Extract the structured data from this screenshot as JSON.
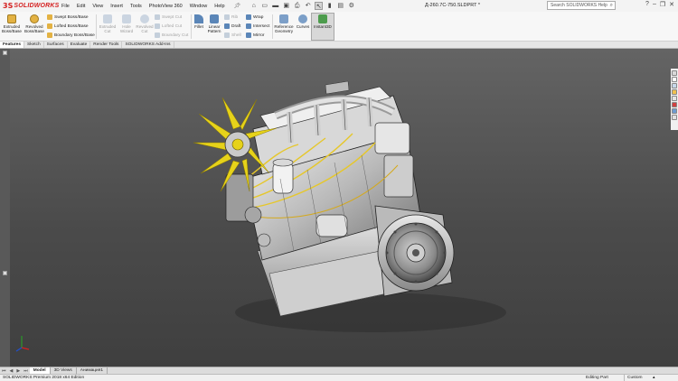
{
  "app": {
    "logo_ds": "3S",
    "logo_text": "SOLIDWORKS"
  },
  "menu": [
    "File",
    "Edit",
    "View",
    "Insert",
    "Tools",
    "PhotoView 360",
    "Window",
    "Help"
  ],
  "document_title": "Д-260.7C-750.SLDPRT *",
  "search": {
    "placeholder": "Search SOLIDWORKS Help"
  },
  "ribbon": {
    "extruded_boss": "Extruded Boss/Base",
    "revolved_boss": "Revolved Boss/Base",
    "swept_boss": "Swept Boss/Base",
    "lofted_boss": "Lofted Boss/Base",
    "boundary_boss": "Boundary Boss/Base",
    "extruded_cut": "Extruded Cut",
    "hole_wizard": "Hole Wizard",
    "revolved_cut": "Revolved Cut",
    "swept_cut": "Swept Cut",
    "lofted_cut": "Lofted Cut",
    "boundary_cut": "Boundary Cut",
    "fillet": "Fillet",
    "linear_pattern": "Linear Pattern",
    "rib": "Rib",
    "draft": "Draft",
    "shell": "Shell",
    "wrap": "Wrap",
    "intersect": "Intersect",
    "mirror": "Mirror",
    "reference_geometry": "Reference Geometry",
    "curves": "Curves",
    "instant3d": "Instant3D"
  },
  "tabs": [
    "Features",
    "Sketch",
    "Surfaces",
    "Evaluate",
    "Render Tools",
    "SOLIDWORKS Add-Ins"
  ],
  "model_tabs": [
    "Model",
    "3D Views",
    "Анимация1"
  ],
  "status": {
    "edition": "SOLIDWORKS Premium 2018 x64 Edition",
    "mode": "Editing Part",
    "units": "Custom"
  },
  "colors": {
    "brand": "#d42020",
    "fan": "#e6d21a",
    "viewport_top": "#646464",
    "viewport_bottom": "#3f3f3f"
  }
}
